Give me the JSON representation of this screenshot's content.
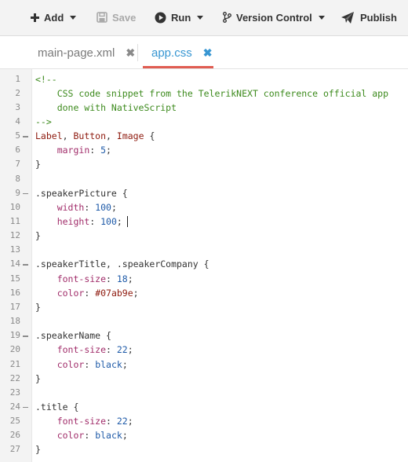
{
  "toolbar": {
    "add": "Add",
    "save": "Save",
    "run": "Run",
    "version_control": "Version Control",
    "publish": "Publish"
  },
  "tabs": [
    {
      "label": "main-page.xml",
      "active": false
    },
    {
      "label": "app.css",
      "active": true
    }
  ],
  "colors": {
    "accent": "#3796d2",
    "tab_underline": "#e05d52",
    "comment": "#3c8a1c",
    "tag": "#8e1a0e",
    "property": "#a12d6a",
    "number": "#1e5aa8"
  },
  "editor": {
    "cursor_line": 11,
    "lines": [
      {
        "n": "1",
        "fold": false,
        "tokens": [
          {
            "t": "<!--",
            "c": "comment"
          }
        ]
      },
      {
        "n": "2",
        "fold": false,
        "tokens": [
          {
            "t": "    CSS code snippet from the TelerikNEXT conference official app",
            "c": "comment"
          }
        ]
      },
      {
        "n": "3",
        "fold": false,
        "tokens": [
          {
            "t": "    done with NativeScript",
            "c": "comment"
          }
        ]
      },
      {
        "n": "4",
        "fold": false,
        "tokens": [
          {
            "t": "-->",
            "c": "comment"
          }
        ]
      },
      {
        "n": "5",
        "fold": true,
        "tokens": [
          {
            "t": "Label",
            "c": "tag"
          },
          {
            "t": ", ",
            "c": "punc"
          },
          {
            "t": "Button",
            "c": "tag"
          },
          {
            "t": ", ",
            "c": "punc"
          },
          {
            "t": "Image",
            "c": "tag"
          },
          {
            "t": " {",
            "c": "punc"
          }
        ]
      },
      {
        "n": "6",
        "fold": false,
        "tokens": [
          {
            "t": "    ",
            "c": "punc"
          },
          {
            "t": "margin",
            "c": "prop"
          },
          {
            "t": ": ",
            "c": "punc"
          },
          {
            "t": "5",
            "c": "num"
          },
          {
            "t": ";",
            "c": "punc"
          }
        ]
      },
      {
        "n": "7",
        "fold": false,
        "tokens": [
          {
            "t": "}",
            "c": "punc"
          }
        ]
      },
      {
        "n": "8",
        "fold": false,
        "tokens": []
      },
      {
        "n": "9",
        "fold": true,
        "tokens": [
          {
            "t": ".speakerPicture",
            "c": "sel"
          },
          {
            "t": " {",
            "c": "punc"
          }
        ]
      },
      {
        "n": "10",
        "fold": false,
        "tokens": [
          {
            "t": "    ",
            "c": "punc"
          },
          {
            "t": "width",
            "c": "prop"
          },
          {
            "t": ": ",
            "c": "punc"
          },
          {
            "t": "100",
            "c": "num"
          },
          {
            "t": ";",
            "c": "punc"
          }
        ]
      },
      {
        "n": "11",
        "fold": false,
        "tokens": [
          {
            "t": "    ",
            "c": "punc"
          },
          {
            "t": "height",
            "c": "prop"
          },
          {
            "t": ": ",
            "c": "punc"
          },
          {
            "t": "100",
            "c": "num"
          },
          {
            "t": ";",
            "c": "punc"
          }
        ]
      },
      {
        "n": "12",
        "fold": false,
        "tokens": [
          {
            "t": "}",
            "c": "punc"
          }
        ]
      },
      {
        "n": "13",
        "fold": false,
        "tokens": []
      },
      {
        "n": "14",
        "fold": true,
        "tokens": [
          {
            "t": ".speakerTitle, .speakerCompany",
            "c": "sel"
          },
          {
            "t": " {",
            "c": "punc"
          }
        ]
      },
      {
        "n": "15",
        "fold": false,
        "tokens": [
          {
            "t": "    ",
            "c": "punc"
          },
          {
            "t": "font-size",
            "c": "prop"
          },
          {
            "t": ": ",
            "c": "punc"
          },
          {
            "t": "18",
            "c": "num"
          },
          {
            "t": ";",
            "c": "punc"
          }
        ]
      },
      {
        "n": "16",
        "fold": false,
        "tokens": [
          {
            "t": "    ",
            "c": "punc"
          },
          {
            "t": "color",
            "c": "prop"
          },
          {
            "t": ": ",
            "c": "punc"
          },
          {
            "t": "#07ab9e",
            "c": "tag"
          },
          {
            "t": ";",
            "c": "punc"
          }
        ]
      },
      {
        "n": "17",
        "fold": false,
        "tokens": [
          {
            "t": "}",
            "c": "punc"
          }
        ]
      },
      {
        "n": "18",
        "fold": false,
        "tokens": []
      },
      {
        "n": "19",
        "fold": true,
        "tokens": [
          {
            "t": ".speakerName",
            "c": "sel"
          },
          {
            "t": " {",
            "c": "punc"
          }
        ]
      },
      {
        "n": "20",
        "fold": false,
        "tokens": [
          {
            "t": "    ",
            "c": "punc"
          },
          {
            "t": "font-size",
            "c": "prop"
          },
          {
            "t": ": ",
            "c": "punc"
          },
          {
            "t": "22",
            "c": "num"
          },
          {
            "t": ";",
            "c": "punc"
          }
        ]
      },
      {
        "n": "21",
        "fold": false,
        "tokens": [
          {
            "t": "    ",
            "c": "punc"
          },
          {
            "t": "color",
            "c": "prop"
          },
          {
            "t": ": ",
            "c": "punc"
          },
          {
            "t": "black",
            "c": "num"
          },
          {
            "t": ";",
            "c": "punc"
          }
        ]
      },
      {
        "n": "22",
        "fold": false,
        "tokens": [
          {
            "t": "}",
            "c": "punc"
          }
        ]
      },
      {
        "n": "23",
        "fold": false,
        "tokens": []
      },
      {
        "n": "24",
        "fold": true,
        "tokens": [
          {
            "t": ".title",
            "c": "sel"
          },
          {
            "t": " {",
            "c": "punc"
          }
        ]
      },
      {
        "n": "25",
        "fold": false,
        "tokens": [
          {
            "t": "    ",
            "c": "punc"
          },
          {
            "t": "font-size",
            "c": "prop"
          },
          {
            "t": ": ",
            "c": "punc"
          },
          {
            "t": "22",
            "c": "num"
          },
          {
            "t": ";",
            "c": "punc"
          }
        ]
      },
      {
        "n": "26",
        "fold": false,
        "tokens": [
          {
            "t": "    ",
            "c": "punc"
          },
          {
            "t": "color",
            "c": "prop"
          },
          {
            "t": ": ",
            "c": "punc"
          },
          {
            "t": "black",
            "c": "num"
          },
          {
            "t": ";",
            "c": "punc"
          }
        ]
      },
      {
        "n": "27",
        "fold": false,
        "tokens": [
          {
            "t": "}",
            "c": "punc"
          }
        ]
      }
    ]
  }
}
